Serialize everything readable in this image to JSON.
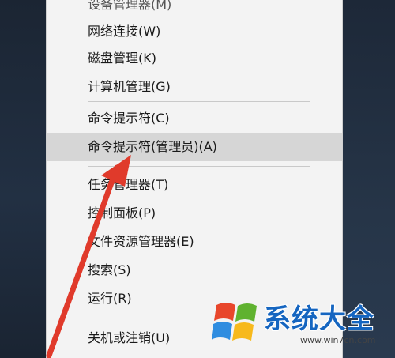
{
  "menu": {
    "items": [
      {
        "label": "设备管理器(M)"
      },
      {
        "label": "网络连接(W)"
      },
      {
        "label": "磁盘管理(K)"
      },
      {
        "label": "计算机管理(G)"
      },
      {
        "label": "命令提示符(C)"
      },
      {
        "label": "命令提示符(管理员)(A)"
      },
      {
        "label": "任务管理器(T)"
      },
      {
        "label": "控制面板(P)"
      },
      {
        "label": "文件资源管理器(E)"
      },
      {
        "label": "搜索(S)"
      },
      {
        "label": "运行(R)"
      },
      {
        "label": "关机或注销(U)"
      }
    ],
    "highlighted": "命令提示符(管理员)(A)"
  },
  "watermark": {
    "title": "系统大全",
    "url": "www.win7cn.com"
  },
  "colors": {
    "arrow": "#e03a2b",
    "highlight": "#d6d6d6",
    "brand": "#1565c0"
  }
}
